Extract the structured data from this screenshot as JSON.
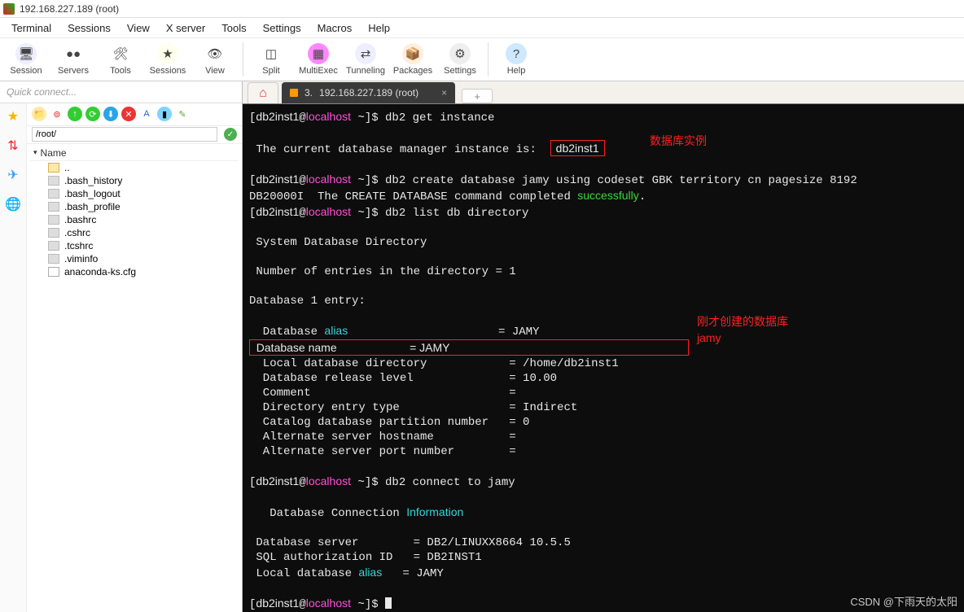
{
  "window": {
    "title": "192.168.227.189 (root)"
  },
  "menus": [
    "Terminal",
    "Sessions",
    "View",
    "X server",
    "Tools",
    "Settings",
    "Macros",
    "Help"
  ],
  "toolbar": [
    {
      "label": "Session",
      "icon": "🖥",
      "bg": "#eef"
    },
    {
      "label": "Servers",
      "icon": "●●",
      "bg": "#fff"
    },
    {
      "label": "Tools",
      "icon": "🛠",
      "bg": "#fff"
    },
    {
      "label": "Sessions",
      "icon": "★",
      "bg": "#ffe"
    },
    {
      "label": "View",
      "icon": "👁",
      "bg": "#fff"
    },
    {
      "sep": true
    },
    {
      "label": "Split",
      "icon": "◫",
      "bg": "#fff"
    },
    {
      "label": "MultiExec",
      "icon": "▦",
      "bg": "#f8f"
    },
    {
      "label": "Tunneling",
      "icon": "⇄",
      "bg": "#eef"
    },
    {
      "label": "Packages",
      "icon": "📦",
      "bg": "#fed"
    },
    {
      "label": "Settings",
      "icon": "⚙",
      "bg": "#eee"
    },
    {
      "sep": true
    },
    {
      "label": "Help",
      "icon": "?",
      "bg": "#cde8ff"
    }
  ],
  "quick_placeholder": "Quick connect...",
  "sidebar_icons": [
    "★",
    "⇅",
    "✈",
    "🌐"
  ],
  "filepane": {
    "path": "/root/",
    "header": "Name",
    "files": [
      {
        "name": "..",
        "type": "folder"
      },
      {
        "name": ".bash_history",
        "type": "file"
      },
      {
        "name": ".bash_logout",
        "type": "file"
      },
      {
        "name": ".bash_profile",
        "type": "file"
      },
      {
        "name": ".bashrc",
        "type": "file"
      },
      {
        "name": ".cshrc",
        "type": "file"
      },
      {
        "name": ".tcshrc",
        "type": "file"
      },
      {
        "name": ".viminfo",
        "type": "file"
      },
      {
        "name": "anaconda-ks.cfg",
        "type": "doc"
      }
    ]
  },
  "tab": {
    "index": "3.",
    "title": "192.168.227.189 (root)"
  },
  "term": {
    "prompt_user": "db2inst1",
    "prompt_host": "localhost",
    "prompt_path": "~",
    "cmd1": "db2 get instance",
    "line_instance_pre": " The current database manager instance is:",
    "instance": "db2inst1",
    "cmd2": "db2 create database jamy using codeset GBK territory cn pagesize 8192",
    "line_create": "DB20000I  The CREATE DATABASE command completed ",
    "create_ok": "successfully",
    "cmd3": "db2 list db directory",
    "sys_dir": " System Database Directory",
    "num_entries": " Number of entries in the directory = 1",
    "db_entry_hdr": "Database 1 entry:",
    "rows": [
      {
        "k": " Database ",
        "k2": "alias",
        "v": "= JAMY",
        "k2c": "cy"
      },
      {
        "k": " Database name",
        "v": "= JAMY"
      },
      {
        "k": " Local database directory",
        "v": "= /home/db2inst1"
      },
      {
        "k": " Database release level",
        "v": "= 10.00"
      },
      {
        "k": " Comment",
        "v": "="
      },
      {
        "k": " Directory entry type",
        "v": "= Indirect"
      },
      {
        "k": " Catalog database partition number",
        "v": "= 0"
      },
      {
        "k": " Alternate server hostname",
        "v": "="
      },
      {
        "k": " Alternate server port number",
        "v": "="
      }
    ],
    "cmd4": "db2 connect to jamy",
    "conn_hdr_pre": "   Database Connection ",
    "conn_hdr_info": "Information",
    "conn_rows": [
      {
        "k": " Database server",
        "v": "= DB2/LINUXX8664 10.5.5"
      },
      {
        "k": " SQL authorization ID",
        "v": "= DB2INST1"
      },
      {
        "k": " Local database ",
        "k2": "alias",
        "v": "= JAMY",
        "k2c": "cy"
      }
    ],
    "ann1": "数据库实例",
    "ann2a": "刚才创建的数据库",
    "ann2b": "jamy"
  },
  "watermark": "CSDN @下雨天的太阳"
}
